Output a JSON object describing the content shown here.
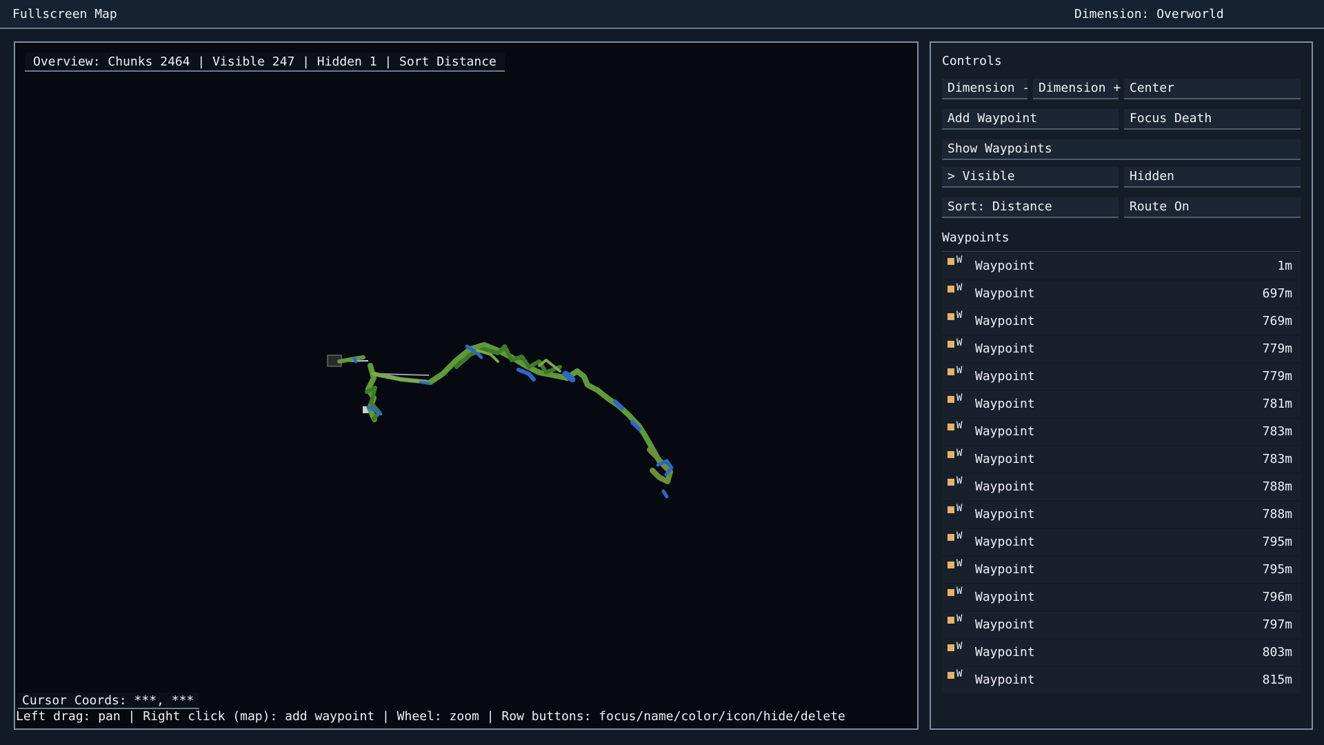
{
  "header": {
    "title": "Fullscreen Map",
    "dimension": "Dimension: Overworld"
  },
  "map": {
    "overview": "Overview: Chunks 2464 | Visible 247 | Hidden 1 | Sort Distance",
    "cursor_coords": "Cursor Coords: ***, ***",
    "help": "Left drag: pan | Right click (map): add waypoint | Wheel: zoom | Row buttons: focus/name/color/icon/hide/delete",
    "colors": {
      "background": "#060a10",
      "terrain_green": "#5f9a3a",
      "terrain_dark_green": "#3f7a2a",
      "water_blue": "#2f66c8",
      "path_gray": "#9aa0a8"
    }
  },
  "controls": {
    "label": "Controls",
    "dimension_minus": "Dimension -",
    "dimension_plus": "Dimension +",
    "center": "Center",
    "add_waypoint": "Add Waypoint",
    "focus_death": "Focus Death",
    "show_waypoints": "Show Waypoints",
    "visible": "> Visible",
    "hidden": "Hidden",
    "sort": "Sort: Distance",
    "route": "Route On"
  },
  "waypoints": {
    "label": "Waypoints",
    "icon_letter": "W",
    "color": "#e3b468",
    "items": [
      {
        "name": "Waypoint",
        "distance": "1m"
      },
      {
        "name": "Waypoint",
        "distance": "697m"
      },
      {
        "name": "Waypoint",
        "distance": "769m"
      },
      {
        "name": "Waypoint",
        "distance": "779m"
      },
      {
        "name": "Waypoint",
        "distance": "779m"
      },
      {
        "name": "Waypoint",
        "distance": "781m"
      },
      {
        "name": "Waypoint",
        "distance": "783m"
      },
      {
        "name": "Waypoint",
        "distance": "783m"
      },
      {
        "name": "Waypoint",
        "distance": "788m"
      },
      {
        "name": "Waypoint",
        "distance": "788m"
      },
      {
        "name": "Waypoint",
        "distance": "795m"
      },
      {
        "name": "Waypoint",
        "distance": "795m"
      },
      {
        "name": "Waypoint",
        "distance": "796m"
      },
      {
        "name": "Waypoint",
        "distance": "797m"
      },
      {
        "name": "Waypoint",
        "distance": "803m"
      },
      {
        "name": "Waypoint",
        "distance": "815m"
      }
    ]
  }
}
